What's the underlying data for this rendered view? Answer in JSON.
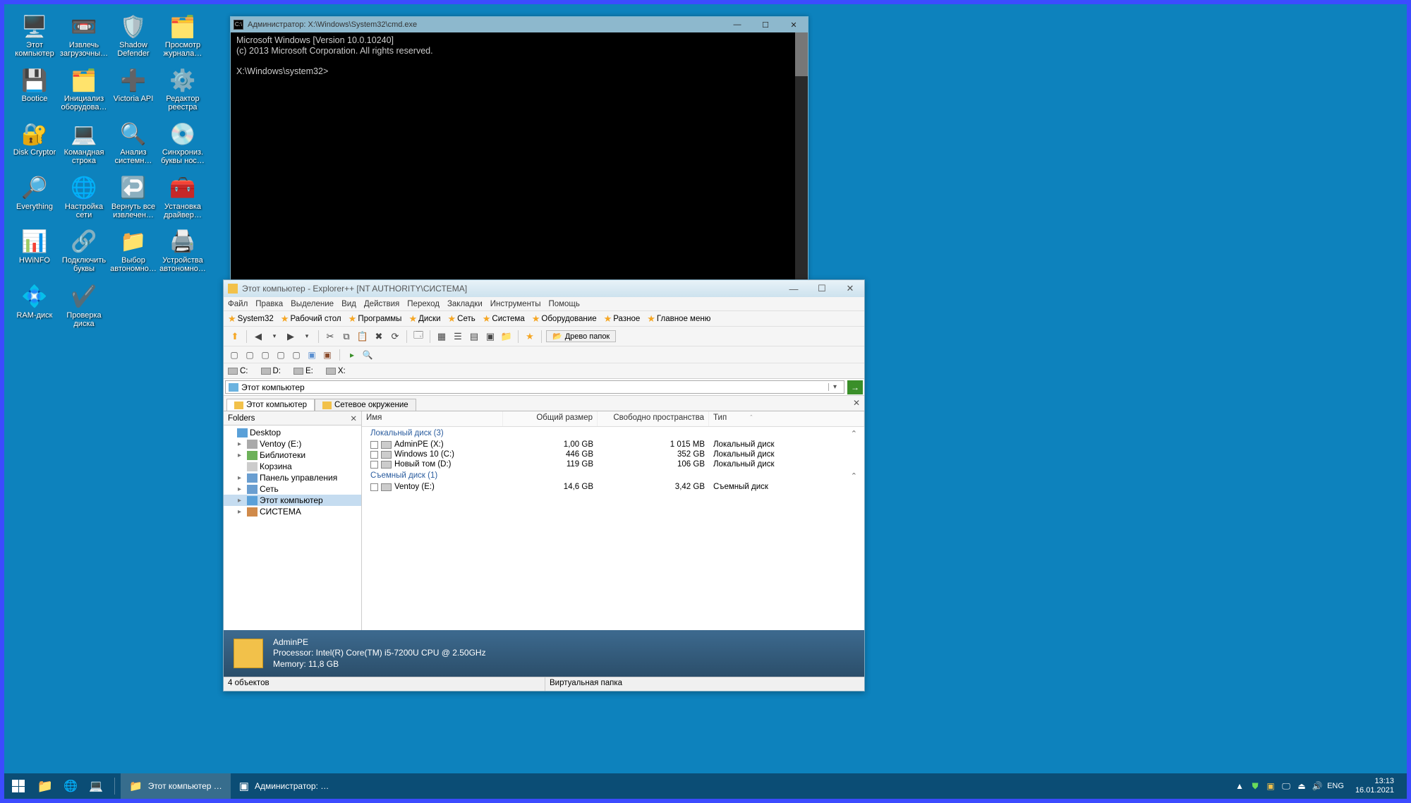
{
  "desktop": {
    "icons": [
      {
        "label": "Этот компьютер",
        "emoji": "🖥️"
      },
      {
        "label": "Извлечь загрузочны…",
        "emoji": "📼"
      },
      {
        "label": "Shadow Defender",
        "emoji": "🛡️"
      },
      {
        "label": "Просмотр журнала…",
        "emoji": "🗂️"
      },
      {
        "label": "Bootice",
        "emoji": "💾"
      },
      {
        "label": "Инициализ оборудова…",
        "emoji": "🗂️"
      },
      {
        "label": "Victoria API",
        "emoji": "➕"
      },
      {
        "label": "Редактор реестра",
        "emoji": "⚙️"
      },
      {
        "label": "Disk Cryptor",
        "emoji": "🔐"
      },
      {
        "label": "Командная строка",
        "emoji": "💻"
      },
      {
        "label": "Анализ системн…",
        "emoji": "🔍"
      },
      {
        "label": "Синхрониз. буквы нос…",
        "emoji": "💿"
      },
      {
        "label": "Everything",
        "emoji": "🔎"
      },
      {
        "label": "Настройка сети",
        "emoji": "🌐"
      },
      {
        "label": "Вернуть все извлечен…",
        "emoji": "↩️"
      },
      {
        "label": "Установка драйвер…",
        "emoji": "🧰"
      },
      {
        "label": "HWiNFO",
        "emoji": "📊"
      },
      {
        "label": "Подключить буквы всех…",
        "emoji": "🔗"
      },
      {
        "label": "Выбор автономно…",
        "emoji": "📁"
      },
      {
        "label": "Устройства автономно…",
        "emoji": "🖨️"
      },
      {
        "label": "RAM-диск",
        "emoji": "💠"
      },
      {
        "label": "Проверка диска",
        "emoji": "✔️"
      }
    ]
  },
  "cmd": {
    "title": "Администратор: X:\\Windows\\System32\\cmd.exe",
    "line1": "Microsoft Windows [Version 10.0.10240]",
    "line2": "(c) 2013 Microsoft Corporation. All rights reserved.",
    "prompt": "X:\\Windows\\system32>"
  },
  "explorer": {
    "title": "Этот компьютер - Explorer++ [NT AUTHORITY\\СИСТЕМА]",
    "menu": [
      "Файл",
      "Правка",
      "Выделение",
      "Вид",
      "Действия",
      "Переход",
      "Закладки",
      "Инструменты",
      "Помощь"
    ],
    "favs": [
      "System32",
      "Рабочий стол",
      "Программы",
      "Диски",
      "Сеть",
      "Система",
      "Оборудование",
      "Разное",
      "Главное меню"
    ],
    "tree_btn": "Древо папок",
    "drives_bar": [
      "C:",
      "D:",
      "E:",
      "X:"
    ],
    "address": "Этот компьютер",
    "tabs": [
      {
        "label": "Этот компьютер",
        "active": true
      },
      {
        "label": "Сетевое окружение",
        "active": false
      }
    ],
    "tree_header": "Folders",
    "tree": [
      {
        "label": "Desktop",
        "indent": 0,
        "icon": "#5aa0d8",
        "arrow": ""
      },
      {
        "label": "Ventoy (E:)",
        "indent": 1,
        "icon": "#aaa",
        "arrow": "▸"
      },
      {
        "label": "Библиотеки",
        "indent": 1,
        "icon": "#6db15a",
        "arrow": "▸"
      },
      {
        "label": "Корзина",
        "indent": 1,
        "icon": "#ccc",
        "arrow": ""
      },
      {
        "label": "Панель управления",
        "indent": 1,
        "icon": "#6a9ed0",
        "arrow": "▸"
      },
      {
        "label": "Сеть",
        "indent": 1,
        "icon": "#6a9ed0",
        "arrow": "▸"
      },
      {
        "label": "Этот компьютер",
        "indent": 1,
        "icon": "#5aa0d8",
        "arrow": "▸",
        "sel": true
      },
      {
        "label": "СИСТЕМА",
        "indent": 1,
        "icon": "#d08a4a",
        "arrow": "▸"
      }
    ],
    "columns": {
      "name": "Имя",
      "size": "Общий размер",
      "free": "Свободно пространства",
      "type": "Тип"
    },
    "group_local": "Локальный диск (3)",
    "rows_local": [
      {
        "name": "AdminPE (X:)",
        "size": "1,00 GB",
        "free": "1 015 MB",
        "type": "Локальный диск"
      },
      {
        "name": "Windows 10 (C:)",
        "size": "446 GB",
        "free": "352 GB",
        "type": "Локальный диск"
      },
      {
        "name": "Новый том (D:)",
        "size": "119 GB",
        "free": "106 GB",
        "type": "Локальный диск"
      }
    ],
    "group_removable": "Съемный диск (1)",
    "rows_removable": [
      {
        "name": "Ventoy (E:)",
        "size": "14,6 GB",
        "free": "3,42 GB",
        "type": "Съемный диск"
      }
    ],
    "info": {
      "name": "AdminPE",
      "cpu": "Processor: Intel(R) Core(TM) i5-7200U CPU @ 2.50GHz",
      "mem": "Memory: 11,8 GB"
    },
    "status_left": "4 объектов",
    "status_right": "Виртуальная папка"
  },
  "taskbar": {
    "apps": [
      {
        "label": "Этот компьютер …",
        "active": true,
        "icon": "📁"
      },
      {
        "label": "Администратор: …",
        "active": false,
        "icon": "▣"
      }
    ],
    "lang": "ENG",
    "time": "13:13",
    "date": "16.01.2021"
  }
}
